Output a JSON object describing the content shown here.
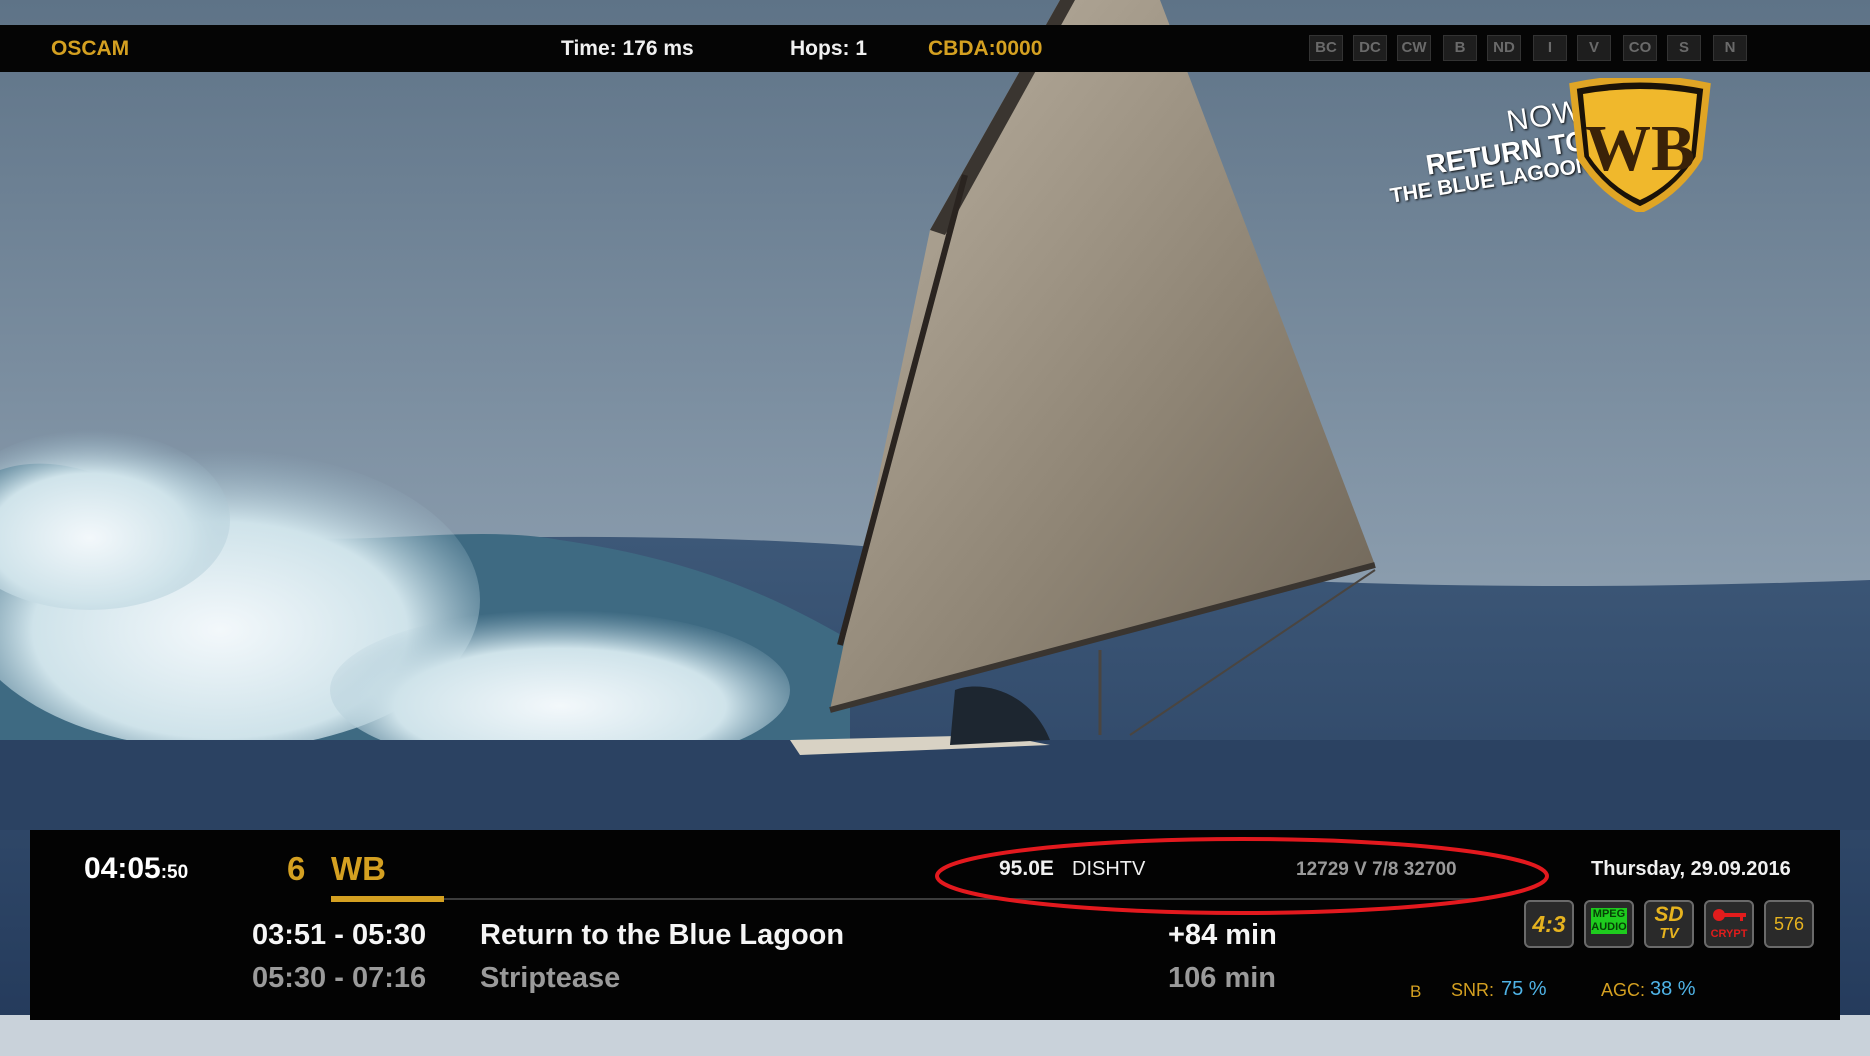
{
  "top_bar": {
    "brand": "OSCAM",
    "time": "Time: 176 ms",
    "hops": "Hops: 1",
    "caid": "CBDA:0000",
    "flags": [
      "BC",
      "DC",
      "CW",
      "B",
      "ND",
      "I",
      "V",
      "CO",
      "S",
      "N"
    ]
  },
  "promo": {
    "line1": "NOW",
    "line2": "RETURN TO",
    "line3": "THE BLUE LAGOON",
    "logo_text": "WB"
  },
  "infobar": {
    "clock": "04:05",
    "clock_seconds": ":50",
    "channel_number": "6",
    "channel_name": "WB",
    "satellite_position": "95.0E",
    "provider": "DISHTV",
    "transponder": "12729 V 7/8 32700",
    "date": "Thursday, 29.09.2016",
    "now_time": "03:51 - 05:30",
    "now_title": "Return to the Blue Lagoon",
    "now_remaining": "+84 min",
    "next_time": "05:30 - 07:16",
    "next_title": "Striptease",
    "next_duration": "106 min",
    "progress_fraction": 0.1,
    "icons": {
      "aspect": "4:3",
      "audio_line1": "MPEG",
      "audio_line2": "AUDIO",
      "sd_line1": "SD",
      "sd_line2": "TV",
      "crypt": "CRYPT",
      "resolution": "576"
    },
    "tuner": "B",
    "snr_label": "SNR:",
    "snr_value": "75 %",
    "agc_label": "AGC:",
    "agc_value": "38 %"
  },
  "colors": {
    "accent": "#d4a021",
    "signal": "#4fb3e6",
    "highlight_oval": "#e3191e"
  }
}
